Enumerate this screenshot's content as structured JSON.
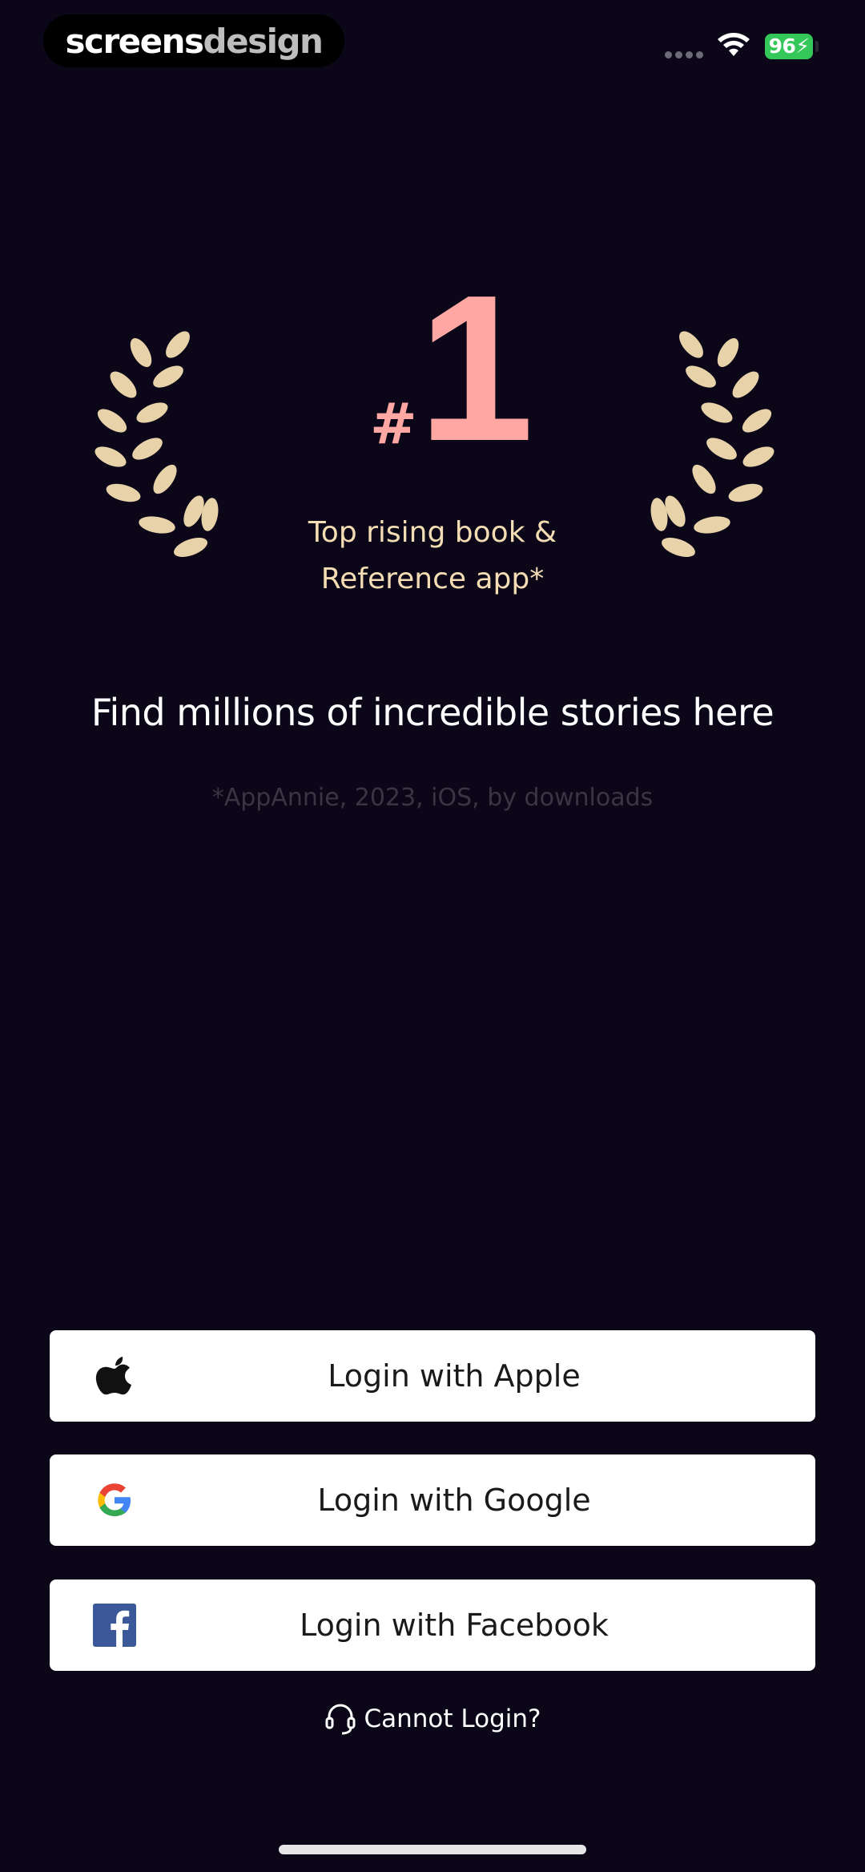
{
  "watermark": {
    "part1": "screens",
    "part2": "design"
  },
  "status_bar": {
    "battery_level": "96",
    "battery_color": "#34c759",
    "icons": [
      "signal-dots-icon",
      "wifi-icon",
      "battery-charging-icon"
    ]
  },
  "award": {
    "hash": "#",
    "rank": "1",
    "caption_line1": "Top rising book &",
    "caption_line2": "Reference app*",
    "accent_color": "#ffa7a2",
    "caption_color": "#f4dcb4",
    "icons": [
      "laurel-left-icon",
      "laurel-right-icon"
    ]
  },
  "headline": "Find millions of incredible stories here",
  "source_note": "*AppAnnie, 2023, iOS, by downloads",
  "login": {
    "apple": {
      "label": "Login with Apple",
      "icon": "apple-icon"
    },
    "google": {
      "label": "Login with Google",
      "icon": "google-icon"
    },
    "facebook": {
      "label": "Login with Facebook",
      "icon": "facebook-icon"
    },
    "cannot_login": {
      "label": "Cannot Login?",
      "icon": "headset-icon"
    }
  },
  "colors": {
    "background": "#0b0718",
    "button_background": "#ffffff",
    "button_text": "#1a1a1a",
    "laurel": "#e8d2aa"
  }
}
